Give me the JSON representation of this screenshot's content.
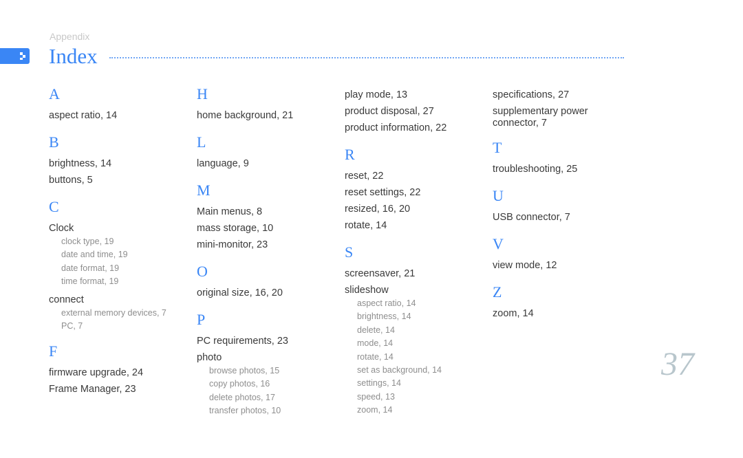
{
  "header": {
    "section": "Appendix",
    "title": "Index",
    "accent_color": "#3a86f5"
  },
  "page_number": "37",
  "columns": [
    {
      "groups": [
        {
          "letter": "A",
          "entries": [
            {
              "text": "aspect ratio,  14"
            }
          ]
        },
        {
          "letter": "B",
          "entries": [
            {
              "text": "brightness,  14"
            },
            {
              "text": "buttons,  5"
            }
          ]
        },
        {
          "letter": "C",
          "entries": [
            {
              "text": "Clock",
              "subs": [
                "clock type,  19",
                "date and time,  19",
                "date format,  19",
                "time format,  19"
              ]
            },
            {
              "text": "connect",
              "subs": [
                "external memory devices,  7",
                "PC,  7"
              ]
            }
          ]
        },
        {
          "letter": "F",
          "entries": [
            {
              "text": "firmware upgrade,  24"
            },
            {
              "text": "Frame Manager,  23"
            }
          ]
        }
      ]
    },
    {
      "groups": [
        {
          "letter": "H",
          "entries": [
            {
              "text": "home background,  21"
            }
          ]
        },
        {
          "letter": "L",
          "entries": [
            {
              "text": "language,  9"
            }
          ]
        },
        {
          "letter": "M",
          "entries": [
            {
              "text": "Main menus,  8"
            },
            {
              "text": "mass storage,  10"
            },
            {
              "text": "mini-monitor,  23"
            }
          ]
        },
        {
          "letter": "O",
          "entries": [
            {
              "text": "original size,  16, 20"
            }
          ]
        },
        {
          "letter": "P",
          "entries": [
            {
              "text": "PC requirements,  23"
            },
            {
              "text": "photo",
              "subs": [
                "browse photos,  15",
                "copy photos,  16",
                "delete photos,  17",
                "transfer photos,  10"
              ]
            }
          ]
        }
      ]
    },
    {
      "groups": [
        {
          "letter": "",
          "entries": [
            {
              "text": "play mode,  13"
            },
            {
              "text": "product disposal,  27"
            },
            {
              "text": "product information,  22"
            }
          ]
        },
        {
          "letter": "R",
          "entries": [
            {
              "text": "reset,  22"
            },
            {
              "text": "reset settings,  22"
            },
            {
              "text": "resized,  16, 20"
            },
            {
              "text": "rotate,  14"
            }
          ]
        },
        {
          "letter": "S",
          "entries": [
            {
              "text": "screensaver,  21"
            },
            {
              "text": "slideshow",
              "subs": [
                "aspect ratio,  14",
                "brightness,  14",
                "delete,  14",
                "mode,  14",
                "rotate,  14",
                "set as background,  14",
                "settings,  14",
                "speed,  13",
                "zoom,  14"
              ]
            }
          ]
        }
      ]
    },
    {
      "groups": [
        {
          "letter": "",
          "entries": [
            {
              "text": "specifications,  27"
            },
            {
              "text": "supplementary power connector,  7",
              "wrap": true
            }
          ]
        },
        {
          "letter": "T",
          "entries": [
            {
              "text": "troubleshooting,  25"
            }
          ]
        },
        {
          "letter": "U",
          "entries": [
            {
              "text": "USB connector,  7"
            }
          ]
        },
        {
          "letter": "V",
          "entries": [
            {
              "text": "view mode,  12"
            }
          ]
        },
        {
          "letter": "Z",
          "entries": [
            {
              "text": "zoom,  14"
            }
          ]
        }
      ]
    }
  ]
}
